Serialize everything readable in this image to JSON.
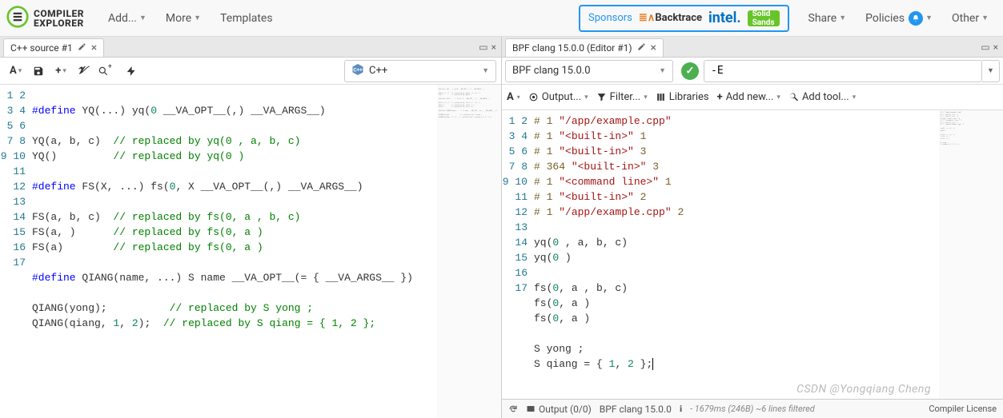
{
  "logo": {
    "line1": "COMPILER",
    "line2": "EXPLORER"
  },
  "nav": {
    "add": "Add...",
    "more": "More",
    "templates": "Templates",
    "sponsors_label": "Sponsors",
    "sponsors": [
      "Backtrace",
      "intel.",
      "Solid Sands"
    ],
    "share": "Share",
    "policies": "Policies",
    "other": "Other"
  },
  "left": {
    "tab_title": "C++ source #1",
    "lang_label": "C++",
    "lines": [
      {
        "n": 1,
        "text": ""
      },
      {
        "n": 2,
        "segs": [
          [
            "kw",
            "#define"
          ],
          [
            "",
            " YQ(...) yq("
          ],
          [
            "num",
            "0"
          ],
          [
            "",
            " __VA_OPT__(,) __VA_ARGS__)"
          ]
        ]
      },
      {
        "n": 3,
        "text": ""
      },
      {
        "n": 4,
        "segs": [
          [
            "",
            "YQ(a, b, c)  "
          ],
          [
            "cm",
            "// replaced by yq(0 , a, b, c)"
          ]
        ]
      },
      {
        "n": 5,
        "segs": [
          [
            "",
            "YQ()         "
          ],
          [
            "cm",
            "// replaced by yq(0 )"
          ]
        ]
      },
      {
        "n": 6,
        "text": ""
      },
      {
        "n": 7,
        "segs": [
          [
            "kw",
            "#define"
          ],
          [
            "",
            " FS(X, ...) fs("
          ],
          [
            "num",
            "0"
          ],
          [
            "",
            ", X __VA_OPT__(,) __VA_ARGS__)"
          ]
        ]
      },
      {
        "n": 8,
        "text": ""
      },
      {
        "n": 9,
        "segs": [
          [
            "",
            "FS(a, b, c)  "
          ],
          [
            "cm",
            "// replaced by fs(0, a , b, c)"
          ]
        ]
      },
      {
        "n": 10,
        "segs": [
          [
            "",
            "FS(a, )      "
          ],
          [
            "cm",
            "// replaced by fs(0, a )"
          ]
        ]
      },
      {
        "n": 11,
        "segs": [
          [
            "",
            "FS(a)        "
          ],
          [
            "cm",
            "// replaced by fs(0, a )"
          ]
        ]
      },
      {
        "n": 12,
        "text": ""
      },
      {
        "n": 13,
        "segs": [
          [
            "kw",
            "#define"
          ],
          [
            "",
            " QIANG(name, ...) S name __VA_OPT__(= { __VA_ARGS__ })"
          ]
        ]
      },
      {
        "n": 14,
        "text": ""
      },
      {
        "n": 15,
        "segs": [
          [
            "",
            "QIANG(yong);          "
          ],
          [
            "cm",
            "// replaced by S yong ;"
          ]
        ]
      },
      {
        "n": 16,
        "segs": [
          [
            "",
            "QIANG(qiang, "
          ],
          [
            "num",
            "1"
          ],
          [
            "",
            ", "
          ],
          [
            "num",
            "2"
          ],
          [
            "",
            ");  "
          ],
          [
            "cm",
            "// replaced by S qiang = { 1, 2 };"
          ]
        ]
      },
      {
        "n": 17,
        "text": ""
      }
    ]
  },
  "right": {
    "tab_title": "BPF clang 15.0.0 (Editor #1)",
    "compiler_label": "BPF clang 15.0.0",
    "options_value": "-E",
    "toolbar2": {
      "output": "Output...",
      "filter": "Filter...",
      "libraries": "Libraries",
      "addnew": "Add new...",
      "addtool": "Add tool..."
    },
    "lines": [
      {
        "n": 1,
        "segs": [
          [
            "mac",
            "# 1 "
          ],
          [
            "str",
            "\"/app/example.cpp\""
          ]
        ]
      },
      {
        "n": 2,
        "segs": [
          [
            "mac",
            "# 1 "
          ],
          [
            "str",
            "\"<built-in>\""
          ],
          [
            "mac",
            " 1"
          ]
        ]
      },
      {
        "n": 3,
        "segs": [
          [
            "mac",
            "# 1 "
          ],
          [
            "str",
            "\"<built-in>\""
          ],
          [
            "mac",
            " 3"
          ]
        ]
      },
      {
        "n": 4,
        "segs": [
          [
            "mac",
            "# 364 "
          ],
          [
            "str",
            "\"<built-in>\""
          ],
          [
            "mac",
            " 3"
          ]
        ]
      },
      {
        "n": 5,
        "segs": [
          [
            "mac",
            "# 1 "
          ],
          [
            "str",
            "\"<command line>\""
          ],
          [
            "mac",
            " 1"
          ]
        ]
      },
      {
        "n": 6,
        "segs": [
          [
            "mac",
            "# 1 "
          ],
          [
            "str",
            "\"<built-in>\""
          ],
          [
            "mac",
            " 2"
          ]
        ]
      },
      {
        "n": 7,
        "segs": [
          [
            "mac",
            "# 1 "
          ],
          [
            "str",
            "\"/app/example.cpp\""
          ],
          [
            "mac",
            " 2"
          ]
        ]
      },
      {
        "n": 8,
        "text": ""
      },
      {
        "n": 9,
        "segs": [
          [
            "",
            "yq("
          ],
          [
            "num",
            "0"
          ],
          [
            "",
            " , a, b, c)"
          ]
        ]
      },
      {
        "n": 10,
        "segs": [
          [
            "",
            "yq("
          ],
          [
            "num",
            "0"
          ],
          [
            "",
            " )"
          ]
        ]
      },
      {
        "n": 11,
        "text": ""
      },
      {
        "n": 12,
        "segs": [
          [
            "",
            "fs("
          ],
          [
            "num",
            "0"
          ],
          [
            "",
            ", a , b, c)"
          ]
        ]
      },
      {
        "n": 13,
        "segs": [
          [
            "",
            "fs("
          ],
          [
            "num",
            "0"
          ],
          [
            "",
            ", a )"
          ]
        ]
      },
      {
        "n": 14,
        "segs": [
          [
            "",
            "fs("
          ],
          [
            "num",
            "0"
          ],
          [
            "",
            ", a )"
          ]
        ]
      },
      {
        "n": 15,
        "text": ""
      },
      {
        "n": 16,
        "segs": [
          [
            "",
            "S yong ;"
          ]
        ]
      },
      {
        "n": 17,
        "segs": [
          [
            "",
            "S qiang = { "
          ],
          [
            "num",
            "1"
          ],
          [
            "",
            ", "
          ],
          [
            "num",
            "2"
          ],
          [
            "",
            " };"
          ]
        ],
        "cursor": true
      }
    ],
    "status": {
      "output_label": "Output (0/0)",
      "compiler": "BPF clang 15.0.0",
      "timing": "- 1679ms (246B) ~6 lines filtered",
      "license": "Compiler License"
    }
  },
  "watermark": "CSDN @Yongqiang Cheng"
}
